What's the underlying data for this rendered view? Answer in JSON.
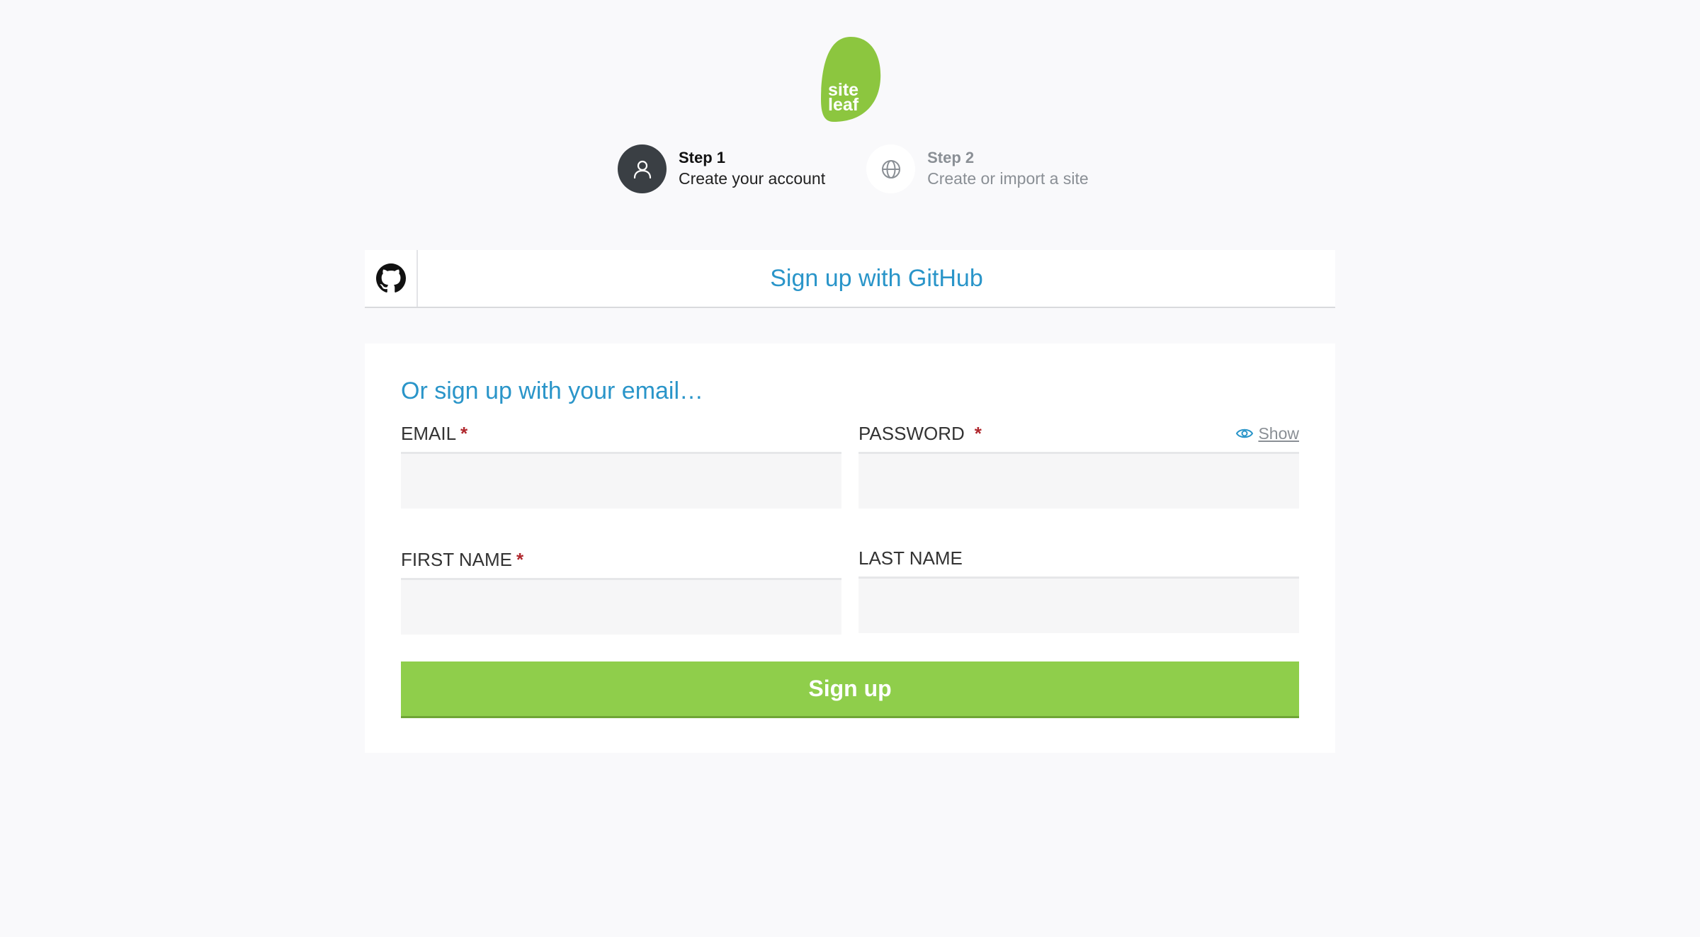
{
  "logo": {
    "line1": "site",
    "line2": "leaf",
    "color": "#8cc63f"
  },
  "steps": [
    {
      "title": "Step 1",
      "subtitle": "Create your account",
      "icon": "user-icon",
      "active": true
    },
    {
      "title": "Step 2",
      "subtitle": "Create or import a site",
      "icon": "globe-icon",
      "active": false
    }
  ],
  "github": {
    "label": "Sign up with GitHub",
    "icon": "github-icon"
  },
  "form": {
    "heading": "Or sign up with your email…",
    "email": {
      "label": "EMAIL",
      "required_mark": "*",
      "value": ""
    },
    "password": {
      "label": "PASSWORD",
      "required_mark": "*",
      "value": "",
      "show_label": "Show",
      "show_icon": "eye-icon"
    },
    "first_name": {
      "label": "FIRST NAME",
      "required_mark": "*",
      "value": ""
    },
    "last_name": {
      "label": "LAST NAME",
      "value": ""
    },
    "submit_label": "Sign up"
  },
  "colors": {
    "accent_blue": "#2a95c9",
    "brand_green": "#8fce4b",
    "required_red": "#b0282e"
  }
}
